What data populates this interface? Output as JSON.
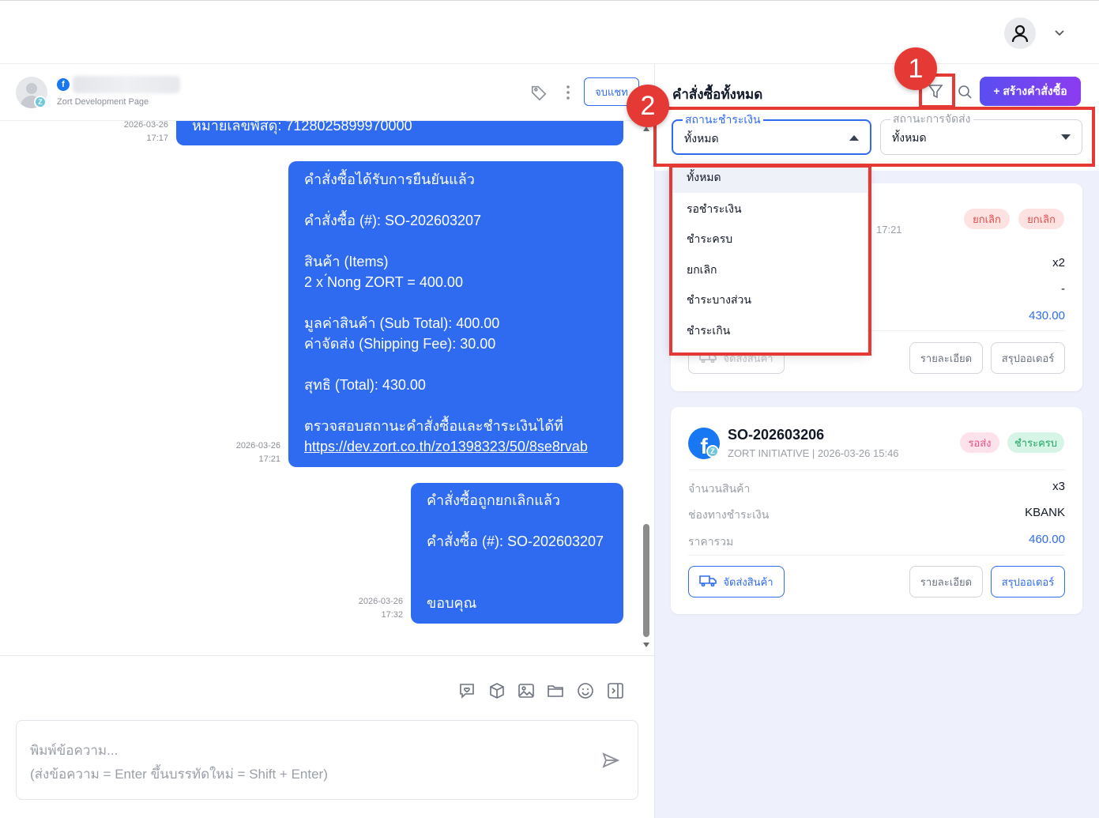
{
  "topbar": {
    "user_icon": "user-icon",
    "chevron_icon": "chevron-down-icon"
  },
  "chat": {
    "page_name": "Zort Development Page",
    "end_chat_label": "จบแชท",
    "messages": [
      {
        "time_date": "2026-03-26",
        "time_clock": "17:17",
        "lines": [
          "หมายเลขพัสดุ: 7128025899970000"
        ]
      },
      {
        "time_date": "2026-03-26",
        "time_clock": "17:21",
        "lines": [
          "คำสั่งซื้อได้รับการยืนยันแล้ว",
          "",
          "คำสั่งซื้อ (#): SO-202603207",
          "",
          "สินค้า (Items)",
          "2 x ́Nong ZORT = 400.00",
          "",
          "มูลค่าสินค้า (Sub Total): 400.00",
          "ค่าจัดส่ง (Shipping Fee): 30.00",
          "",
          "สุทธิ (Total): 430.00",
          "",
          "ตรวจสอบสถานะคำสั่งซื้อและชำระเงินได้ที่"
        ],
        "link": "https://dev.zort.co.th/zo1398323/50/8se8rvab"
      },
      {
        "time_date": "2026-03-26",
        "time_clock": "17:32",
        "lines": [
          "คำสั่งซื้อถูกยกเลิกแล้ว",
          "",
          "คำสั่งซื้อ (#): SO-202603207",
          "",
          "",
          "ขอบคุณ"
        ]
      }
    ],
    "toolbar_icons": [
      "quick-reply-icon",
      "product-box-icon",
      "image-icon",
      "folder-icon",
      "emoji-icon",
      "sidebar-toggle-icon"
    ],
    "input_placeholder_1": "พิมพ์ข้อความ...",
    "input_placeholder_2": "(ส่งข้อความ = Enter ขึ้นบรรทัดใหม่ = Shift + Enter)"
  },
  "orders": {
    "title": "คำสั่งซื้อทั้งหมด",
    "create_label": "+ สร้างคำสั่งซื้อ",
    "payment_filter": {
      "label": "สถานะชำระเงิน",
      "value": "ทั้งหมด"
    },
    "shipping_filter": {
      "label": "สถานะการจัดส่ง",
      "value": "ทั้งหมด"
    },
    "dropdown_options": [
      "ทั้งหมด",
      "รอชำระเงิน",
      "ชำระครบ",
      "ยกเลิก",
      "ชำระบางส่วน",
      "ชำระเกิน"
    ],
    "card1": {
      "time": "17:21",
      "badges": [
        "ยกเลิก",
        "ยกเลิก"
      ],
      "qty": "x2",
      "payment": "-",
      "total": "430.00",
      "ship_label": "จัดส่งสินค้า",
      "detail_label": "รายละเอียด",
      "summary_label": "สรุปออเดอร์"
    },
    "card2": {
      "order_no": "SO-202603206",
      "meta": "ZORT INITIATIVE | 2026-03-26 15:46",
      "badges": [
        "รอส่ง",
        "ชำระครบ"
      ],
      "qty_label": "จำนวนสินค้า",
      "qty": "x3",
      "payment_label": "ช่องทางชำระเงิน",
      "payment": "KBANK",
      "total_label": "ราคารวม",
      "total": "460.00",
      "ship_label": "จัดส่งสินค้า",
      "detail_label": "รายละเอียด",
      "summary_label": "สรุปออเดอร์"
    }
  },
  "annotations": {
    "marker_1": "1",
    "marker_2": "2"
  },
  "colors": {
    "accent": "#2f6bf0",
    "highlight": "#e53935",
    "create_gradient_start": "#5a4ef0",
    "create_gradient_end": "#8b3cf0"
  }
}
